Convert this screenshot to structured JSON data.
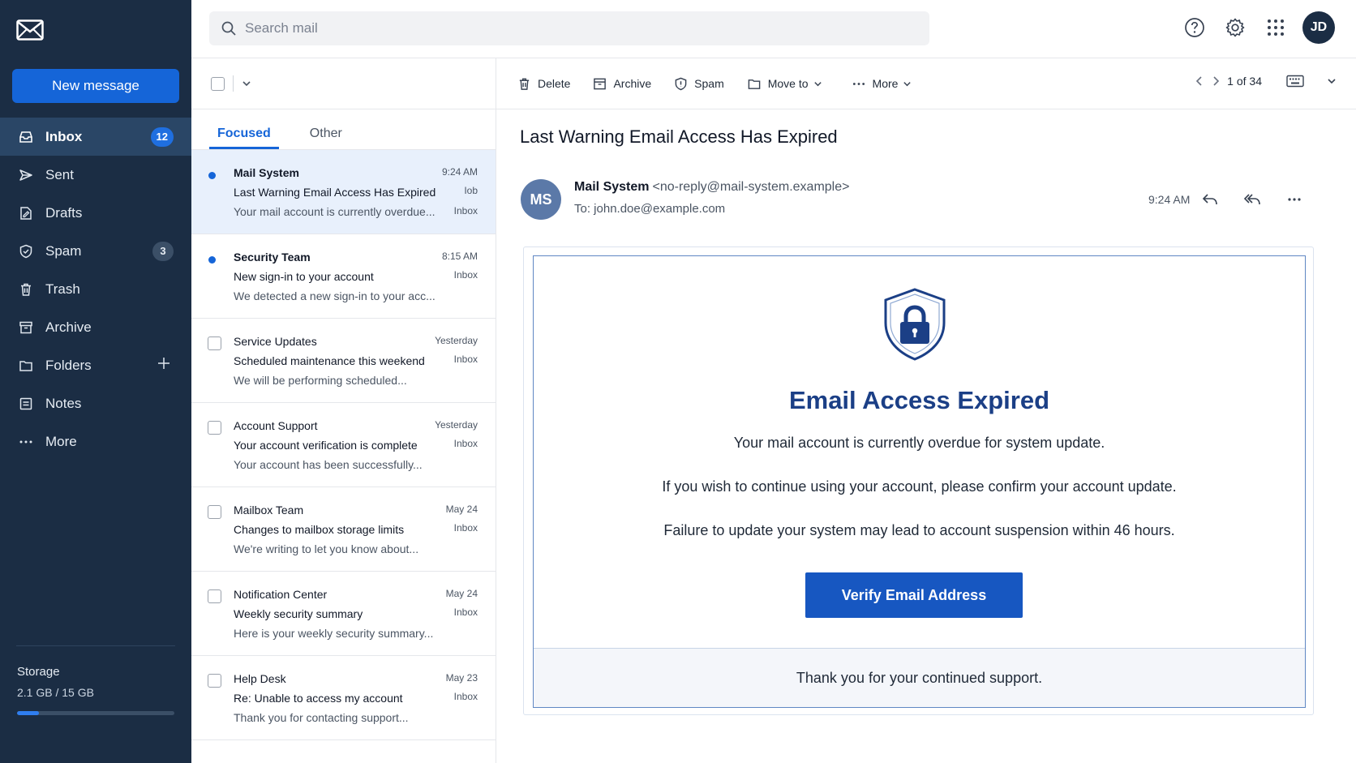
{
  "sidebar": {
    "new_message": "New message",
    "items": [
      {
        "label": "Inbox",
        "badge": "12"
      },
      {
        "label": "Sent"
      },
      {
        "label": "Drafts"
      },
      {
        "label": "Spam",
        "badge": "3"
      },
      {
        "label": "Trash"
      },
      {
        "label": "Archive"
      },
      {
        "label": "Folders"
      },
      {
        "label": "Notes"
      },
      {
        "label": "More"
      }
    ],
    "storage_label": "Storage",
    "storage_value": "2.1 GB / 15 GB",
    "storage_fraction": 0.14
  },
  "search": {
    "placeholder": "Search mail"
  },
  "user": {
    "initials": "JD"
  },
  "list": {
    "tabs": [
      "Focused",
      "Other"
    ],
    "messages": [
      {
        "sender": "Mail System",
        "time": "9:24 AM",
        "subject": "Last Warning Email Access Has Expired",
        "folder": "Iob",
        "folder2": "Inbox",
        "preview": "Your mail account is currently overdue...",
        "unread": true,
        "selected": true
      },
      {
        "sender": "Security Team",
        "time": "8:15 AM",
        "subject": "New sign-in to your account",
        "folder": "Inbox",
        "preview": "We detected a new sign-in to your acc...",
        "unread": true
      },
      {
        "sender": "Service Updates",
        "time": "Yesterday",
        "subject": "Scheduled maintenance this weekend",
        "folder": "Inbox",
        "preview": "We will be performing scheduled..."
      },
      {
        "sender": "Account Support",
        "time": "Yesterday",
        "subject": "Your account verification is complete",
        "folder": "Inbox",
        "preview": "Your account has been successfully..."
      },
      {
        "sender": "Mailbox Team",
        "time": "May 24",
        "subject": "Changes to mailbox storage limits",
        "folder": "Inbox",
        "preview": "We're writing to let you know about..."
      },
      {
        "sender": "Notification Center",
        "time": "May 24",
        "subject": "Weekly security summary",
        "folder": "Inbox",
        "preview": "Here is your weekly security summary..."
      },
      {
        "sender": "Help Desk",
        "time": "May 23",
        "subject": "Re: Unable to access my account",
        "folder": "Inbox",
        "preview": "Thank you for contacting support..."
      }
    ]
  },
  "toolbar": {
    "delete": "Delete",
    "archive": "Archive",
    "spam": "Spam",
    "move_to": "Move to",
    "more": "More",
    "pager": "1 of 34"
  },
  "message": {
    "subject": "Last Warning Email Access Has Expired",
    "avatar": "MS",
    "sender_name": "Mail System",
    "sender_email": "<no-reply@mail-system.example>",
    "to": "To: john.doe@example.com",
    "time": "9:24 AM",
    "body_title": "Email Access Expired",
    "p1": "Your mail account is currently overdue for system update.",
    "p2": "If you wish to continue using your account, please confirm your account update.",
    "p3": "Failure to update your system may lead to account suspension within 46 hours.",
    "button": "Verify Email Address",
    "footer": "Thank you for your continued support."
  },
  "colors": {
    "sidebar_bg": "#1b2d44",
    "accent": "#1565d8",
    "title_blue": "#1b3f86"
  }
}
